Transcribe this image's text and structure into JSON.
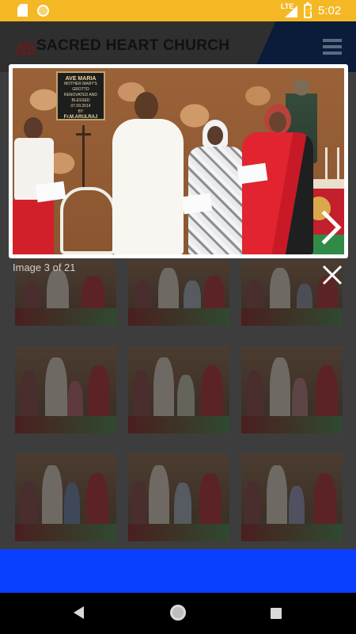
{
  "status_bar": {
    "network": "LTE",
    "time": "5:02"
  },
  "header": {
    "title": "SACRED HEART CHURCH"
  },
  "lightbox": {
    "counter": "Image 3 of 21",
    "plaque": {
      "heading": "AVE MARIA",
      "line1": "MOTHER MARY'S GROTTO",
      "line2": "RENOVATED AND BLESSED",
      "line3": "BY",
      "line4": "Fr.M.ARULRAJ",
      "date": "07.09.2014"
    }
  },
  "gallery": {
    "thumbnail_count": 9
  },
  "colors": {
    "status_bar": "#f4b825",
    "bottom_bar": "#0a3fff",
    "header_accent": "#0a1c3a"
  },
  "icons": {
    "next": "chevron-right-icon",
    "close": "close-icon",
    "menu": "hamburger-menu-icon",
    "back": "back-triangle-icon",
    "home": "home-circle-icon",
    "recent": "recent-apps-square-icon"
  }
}
